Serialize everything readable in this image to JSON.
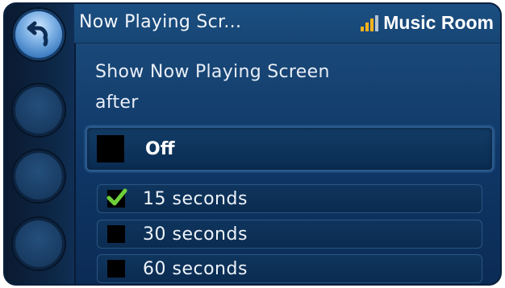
{
  "header": {
    "title": "Now Playing Scr...",
    "room": "Music Room",
    "signal_icon": "signal-strength-icon",
    "signal_color": "#f4b21d"
  },
  "nav": {
    "back_icon": "back-arrow-icon"
  },
  "prompt": {
    "line1": "Show Now Playing Screen",
    "line2": "after"
  },
  "options": [
    {
      "label": "Off",
      "checked": false
    },
    {
      "label": "15 seconds",
      "checked": true
    },
    {
      "label": "30 seconds",
      "checked": false
    },
    {
      "label": "60 seconds",
      "checked": false
    }
  ],
  "colors": {
    "background": "#0f3766",
    "check": "#6fcf3a"
  }
}
